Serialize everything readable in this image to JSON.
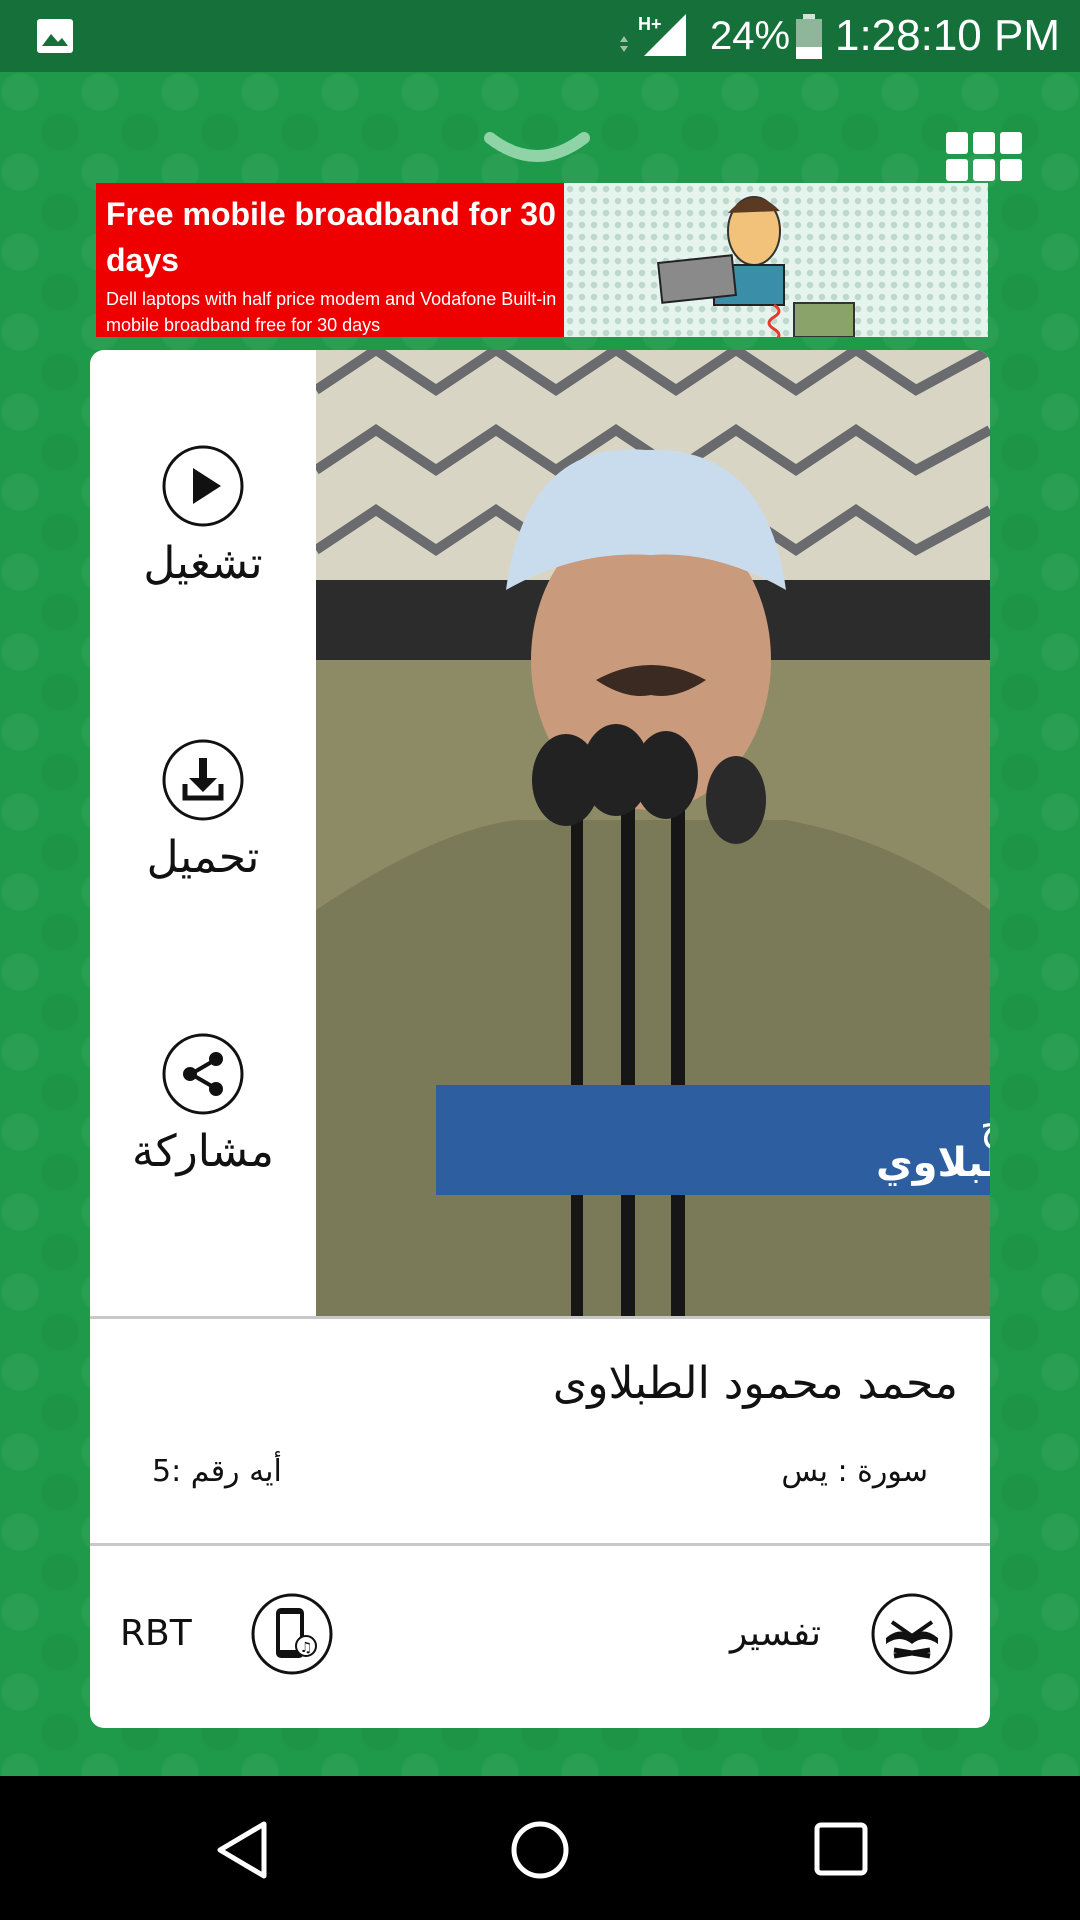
{
  "status_bar": {
    "network": "H+",
    "battery": "24%",
    "time": "1:28:10 PM"
  },
  "ad": {
    "headline": "Free mobile broadband for 30 days",
    "subtext": "Dell laptops with half price modem and Vodafone Built-in mobile broadband free for 30 days"
  },
  "actions": [
    {
      "label": "تشغيل",
      "icon": "play-icon"
    },
    {
      "label": "تحميل",
      "icon": "download-icon"
    },
    {
      "label": "مشاركة",
      "icon": "share-icon"
    }
  ],
  "photo_caption": {
    "line1": "الشيخ",
    "line2": "محمد محمود الطبلاوي"
  },
  "track": {
    "reciter": "محمد محمود الطبلاوى",
    "surah": "سورة : يس",
    "ayah": "أيه رقم :5"
  },
  "bottom": {
    "tafsir_label": "تفسير",
    "rbt_label": "RBT"
  },
  "colors": {
    "brand_green": "#1f9a4a",
    "status_green": "#16703a",
    "ad_red": "#ee0000"
  }
}
